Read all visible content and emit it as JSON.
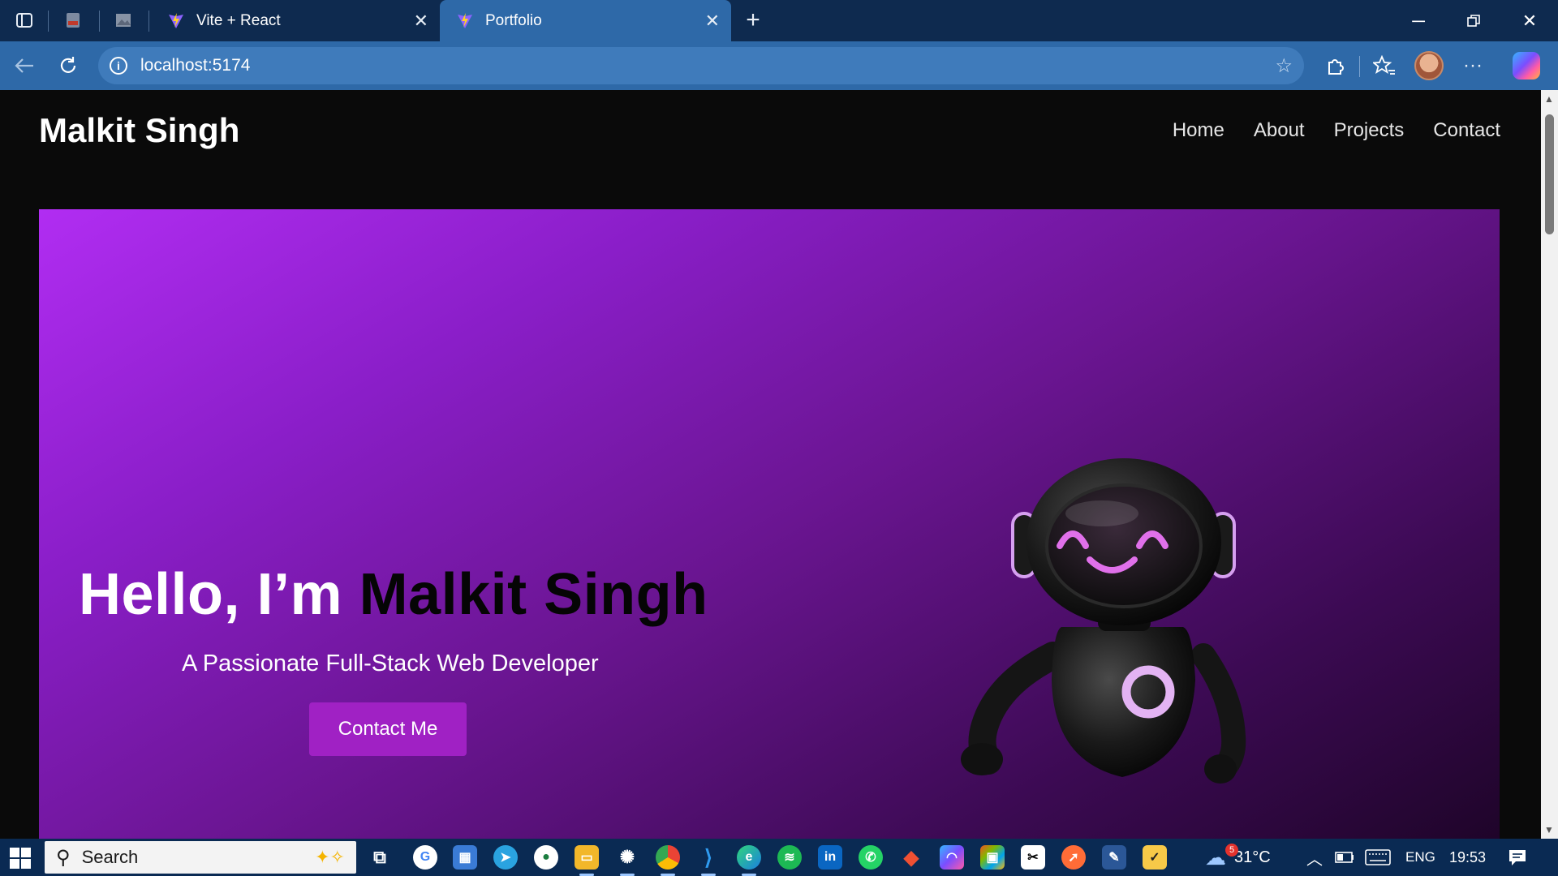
{
  "browser": {
    "tabs": [
      {
        "label": "Vite + React",
        "icon": "vite-icon",
        "active": false
      },
      {
        "label": "Portfolio",
        "icon": "vite-icon",
        "active": true
      }
    ],
    "address": {
      "url": "localhost:5174"
    }
  },
  "page": {
    "logo": "Malkit Singh",
    "nav": [
      "Home",
      "About",
      "Projects",
      "Contact"
    ],
    "hero": {
      "greeting": "Hello, I’m",
      "name": "Malkit Singh",
      "subtitle": "A Passionate Full-Stack Web Developer",
      "cta": "Contact Me"
    }
  },
  "taskbar": {
    "search_label": "Search",
    "weather_badge": "5",
    "temperature": "31°C",
    "language": "ENG",
    "time": "19:53"
  },
  "colors": {
    "hero_gradient_start": "#b12df2",
    "hero_gradient_end": "#1d0427",
    "cta_bg": "#a021c4",
    "browser_toolbar": "#2e69a8",
    "taskbar": "#0a2a53"
  }
}
